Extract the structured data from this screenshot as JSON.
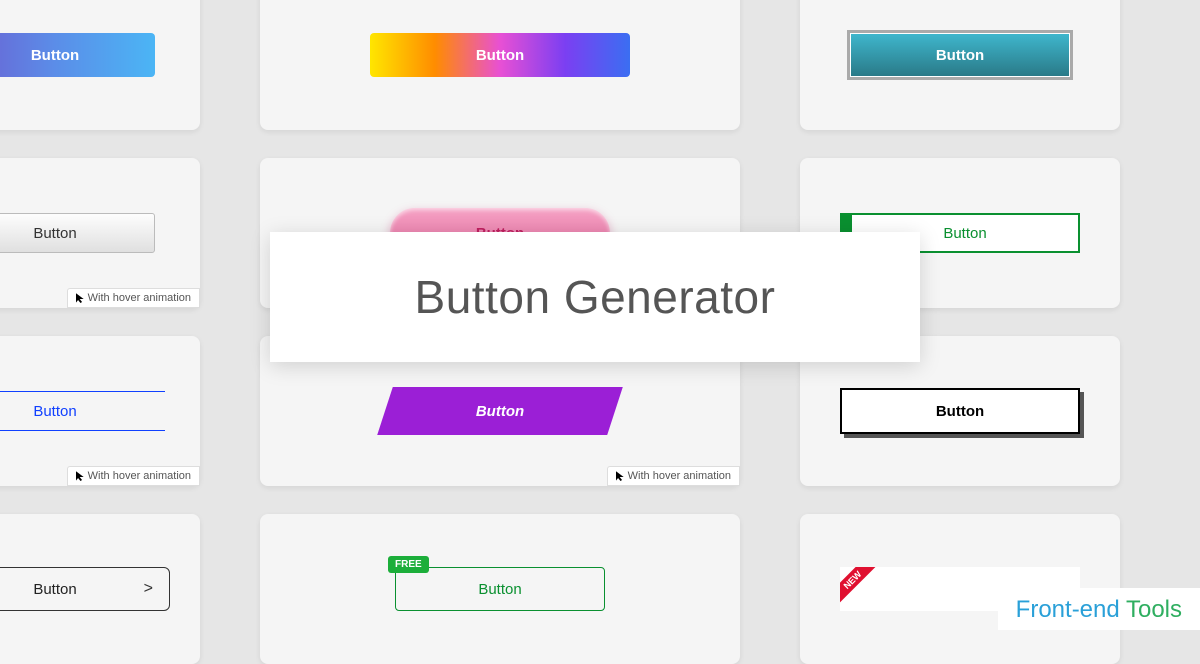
{
  "title": "Button Generator",
  "brand": {
    "front": "Front-end ",
    "tools": "Tools"
  },
  "hover_label": "With hover animation",
  "btn1": {
    "label": "Button"
  },
  "btn2": {
    "label": "Button"
  },
  "btn3": {
    "label": "Button"
  },
  "btn4": {
    "label": "Button"
  },
  "btn5": {
    "label": "Button"
  },
  "btn6": {
    "label": "Button"
  },
  "btn7": {
    "label": "Button"
  },
  "btn8": {
    "label": "Button"
  },
  "btn9": {
    "label": "Button"
  },
  "btn10": {
    "label": "Button",
    "chevron": ">"
  },
  "btn11": {
    "label": "Button",
    "badge": "FREE"
  },
  "btn12": {
    "ribbon": "NEW"
  }
}
